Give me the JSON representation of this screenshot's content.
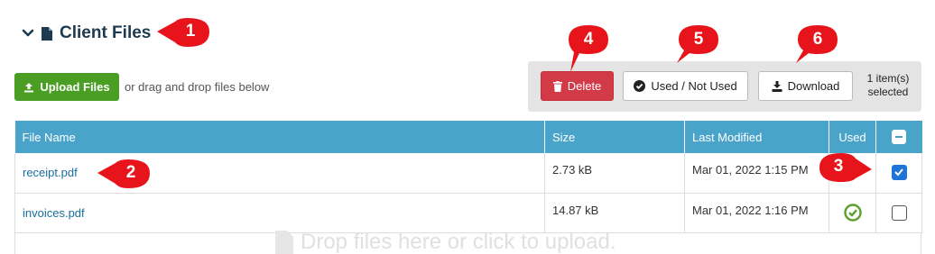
{
  "section": {
    "title": "Client Files",
    "collapse_icon": "chevron-down-icon",
    "file_icon": "file-icon"
  },
  "upload": {
    "button_label": "Upload Files",
    "drag_hint": "or drag and drop files below"
  },
  "actions": {
    "delete_label": "Delete",
    "used_label": "Used / Not Used",
    "download_label": "Download",
    "selected_count": "1 item(s)",
    "selected_suffix": "selected"
  },
  "table": {
    "headers": [
      "File Name",
      "Size",
      "Last Modified",
      "Used"
    ],
    "rows": [
      {
        "name": "receipt.pdf",
        "size": "2.73 kB",
        "modified": "Mar 01, 2022 1:15 PM",
        "used": false,
        "checked": true
      },
      {
        "name": "invoices.pdf",
        "size": "14.87 kB",
        "modified": "Mar 01, 2022 1:16 PM",
        "used": true,
        "checked": false
      }
    ]
  },
  "dropzone": {
    "text": "Drop files here or click to upload."
  },
  "callouts": [
    "1",
    "2",
    "3",
    "4",
    "5",
    "6"
  ],
  "colors": {
    "header_bg": "#4aa3c9",
    "upload_green": "#4a9e23",
    "delete_red": "#d23a48",
    "callout_red": "#e8141c",
    "link_blue": "#1a6e9e",
    "used_green": "#5aa02c",
    "checkbox_blue": "#1e74d8"
  }
}
